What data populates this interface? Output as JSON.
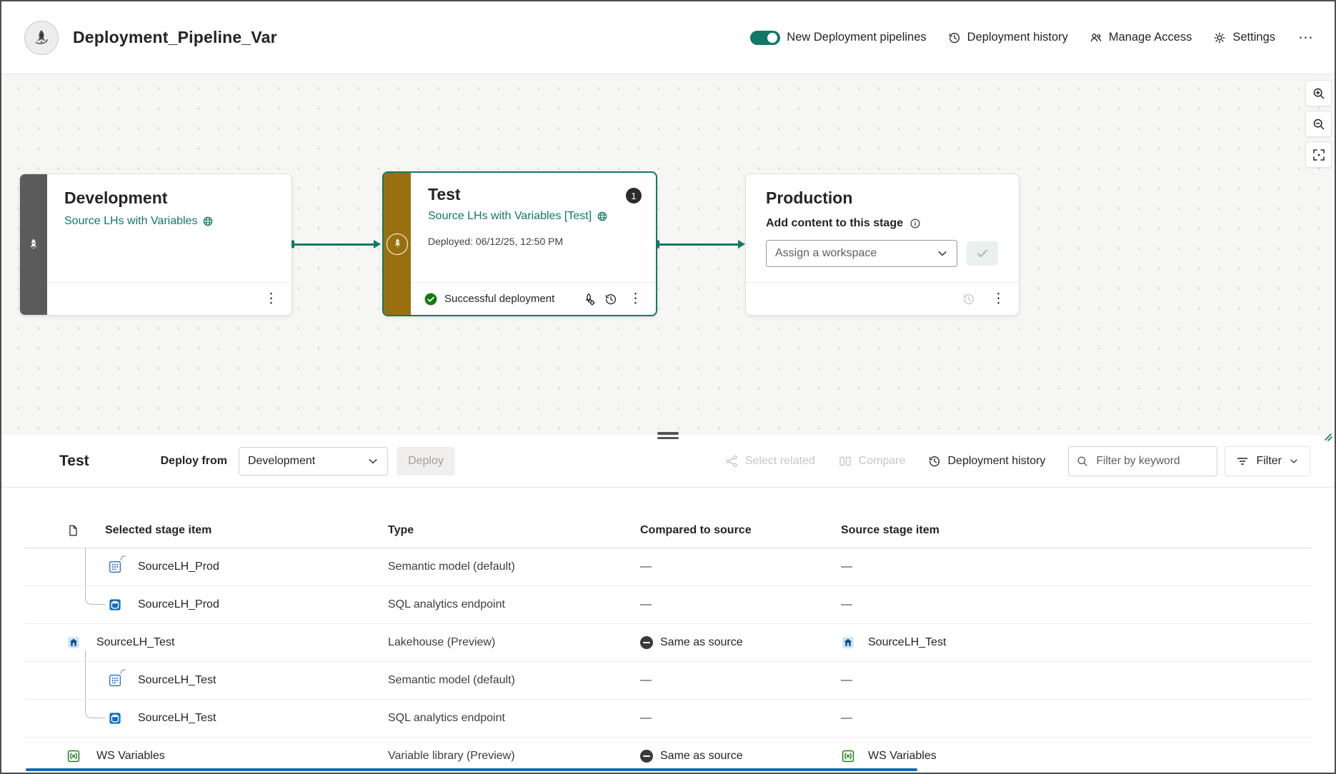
{
  "header": {
    "title": "Deployment_Pipeline_Var",
    "toggle_label": "New Deployment pipelines",
    "history_label": "Deployment history",
    "manage_access_label": "Manage Access",
    "settings_label": "Settings"
  },
  "icons": {
    "kebab": "⋮",
    "more": "⋯"
  },
  "colors": {
    "accent_teal": "#117865",
    "test_strip_gold": "#99700e",
    "dev_strip_gray": "#5b5b5b",
    "success_green": "#107c10",
    "scrollbar_blue": "#0f6cbd"
  },
  "canvas": {
    "stages": [
      {
        "name": "Development",
        "workspace": "Source LHs with Variables"
      },
      {
        "name": "Test",
        "badge": "1",
        "workspace": "Source LHs with Variables [Test]",
        "deployed": "Deployed: 06/12/25, 12:50 PM",
        "status": "Successful deployment"
      },
      {
        "name": "Production",
        "add_content_label": "Add content to this stage",
        "assign_placeholder": "Assign a workspace"
      }
    ]
  },
  "panel": {
    "title": "Test",
    "deploy_from_label": "Deploy from",
    "deploy_from_value": "Development",
    "deploy_button": "Deploy",
    "select_related": "Select related",
    "compare": "Compare",
    "deployment_history": "Deployment history",
    "filter_placeholder": "Filter by keyword",
    "filter_button": "Filter"
  },
  "table": {
    "columns": [
      "Selected stage item",
      "Type",
      "Compared to source",
      "Source stage item"
    ],
    "rows": [
      {
        "name": "SourceLH_Prod",
        "type": "Semantic model (default)",
        "compared": "—",
        "source": "—"
      },
      {
        "name": "SourceLH_Prod",
        "type": "SQL analytics endpoint",
        "compared": "—",
        "source": "—"
      },
      {
        "name": "SourceLH_Test",
        "type": "Lakehouse (Preview)",
        "compared": "Same as source",
        "source": "SourceLH_Test"
      },
      {
        "name": "SourceLH_Test",
        "type": "Semantic model (default)",
        "compared": "—",
        "source": "—"
      },
      {
        "name": "SourceLH_Test",
        "type": "SQL analytics endpoint",
        "compared": "—",
        "source": "—"
      },
      {
        "name": "WS Variables",
        "type": "Variable library (Preview)",
        "compared": "Same as source",
        "source": "WS Variables"
      }
    ]
  }
}
